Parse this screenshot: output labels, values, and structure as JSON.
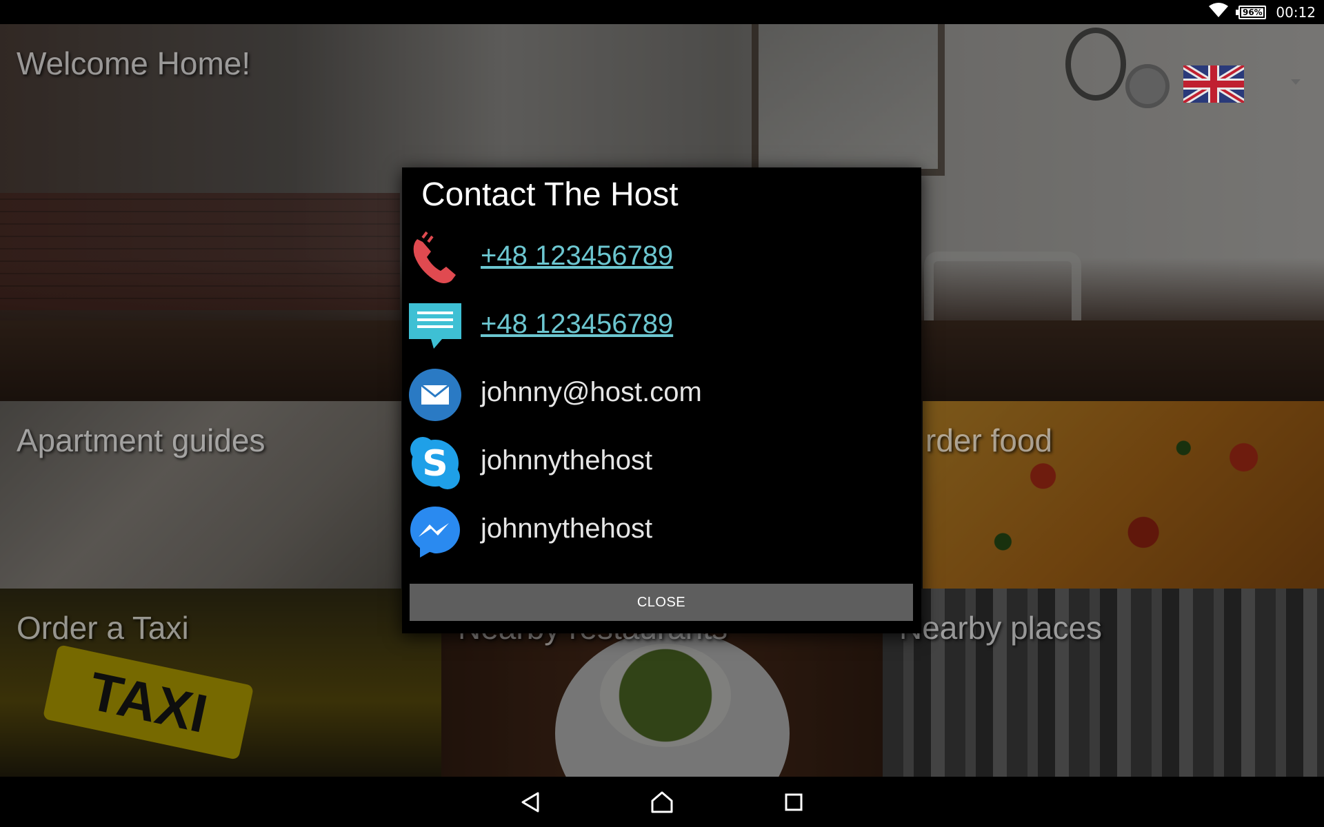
{
  "status_bar": {
    "battery": "96%",
    "time": "00:12",
    "wifi_icon": "wifi-icon",
    "battery_icon": "battery-icon"
  },
  "tiles": {
    "home": "Welcome Home!",
    "guides": "Apartment guides",
    "food": "rder food",
    "taxi": "Order a Taxi",
    "taxi_sign": "TAXI",
    "restaurants": "Nearby restaurants",
    "places": "Nearby places"
  },
  "header_icons": {
    "settings": "gear-icon",
    "language": "uk-flag-icon",
    "dropdown": "chevron-down-icon"
  },
  "dialog": {
    "title": "Contact The Host",
    "contacts": [
      {
        "type": "phone",
        "icon": "phone-icon",
        "value": "+48 123456789",
        "link": true
      },
      {
        "type": "sms",
        "icon": "message-icon",
        "value": "+48 123456789",
        "link": true
      },
      {
        "type": "email",
        "icon": "email-icon",
        "value": "johnny@host.com",
        "link": false
      },
      {
        "type": "skype",
        "icon": "skype-icon",
        "value": "johnnythehost",
        "link": false
      },
      {
        "type": "messenger",
        "icon": "messenger-icon",
        "value": "johnnythehost",
        "link": false
      }
    ],
    "close_label": "CLOSE"
  },
  "nav_bar": {
    "back": "back-icon",
    "home": "home-icon",
    "recents": "recents-icon"
  },
  "colors": {
    "link": "#6cc6d0",
    "phone_icon": "#e04a50",
    "sms_icon": "#3ec0d4",
    "email_icon": "#2a7ac4",
    "skype_icon": "#1fa0e8",
    "messenger_icon": "#2a8af0",
    "close_button": "#5e5e5e"
  }
}
